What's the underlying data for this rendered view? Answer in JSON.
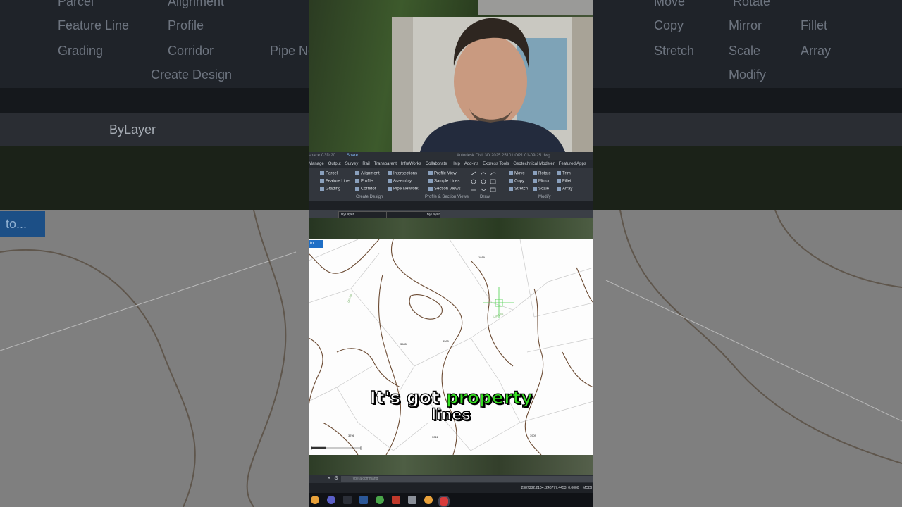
{
  "background": {
    "ribbon_items_left": [
      "Parcel",
      "Alignment",
      "Feature Line",
      "Profile",
      "Grading",
      "Corridor",
      "Pipe Ne"
    ],
    "ribbon_items_right": [
      "Move",
      "Rotate",
      "Copy",
      "Mirror",
      "Fillet",
      "Stretch",
      "Scale",
      "Array"
    ],
    "panel_create_design": "Create Design",
    "panel_modify": "Modify",
    "layer_value": "ByLayer",
    "tooltip_partial": "to..."
  },
  "autocad": {
    "title": "Autodesk Civil 3D 2025    25101 OP1 01-09-25.dwg",
    "workspace": "space C3D 20...",
    "share": "Share",
    "menu": [
      "Manage",
      "Output",
      "Survey",
      "Rail",
      "Transparent",
      "InfraWorks",
      "Collaborate",
      "Help",
      "Add-ins",
      "Express Tools",
      "Geotechnical Modeler",
      "Featured Apps"
    ],
    "ribbon": {
      "create_design": [
        "Parcel",
        "Feature Line",
        "Grading",
        "Alignment",
        "Profile",
        "Corridor",
        "Intersections",
        "Assembly",
        "Pipe Network"
      ],
      "profile_section": [
        "Profile View",
        "Sample Lines",
        "Section Views"
      ],
      "modify": [
        "Move",
        "Copy",
        "Stretch",
        "Rotate",
        "Mirror",
        "Scale",
        "Trim",
        "Fillet",
        "Array"
      ],
      "panels": [
        "Create Design",
        "Profile & Section Views",
        "Draw",
        "Modify"
      ]
    },
    "layer_property": "ByLayer",
    "linetype_property": "ByLayer",
    "tooltip": "to...",
    "parcel_labels": [
      "1919",
      "3565",
      "3909",
      "3796",
      "3011",
      "3585"
    ],
    "contour_labels": [
      "956.00",
      "5,995.00"
    ],
    "command_placeholder": "Type a command",
    "coordinates": "2387382.2104, 246777.4453, 0.0000",
    "mode": "MODI"
  },
  "caption": {
    "line1_a": "It's got",
    "line1_highlight": "property",
    "line2": "lines"
  },
  "colors": {
    "caption_highlight": "#35e021",
    "tooltip_blue": "#1f6fc6"
  }
}
